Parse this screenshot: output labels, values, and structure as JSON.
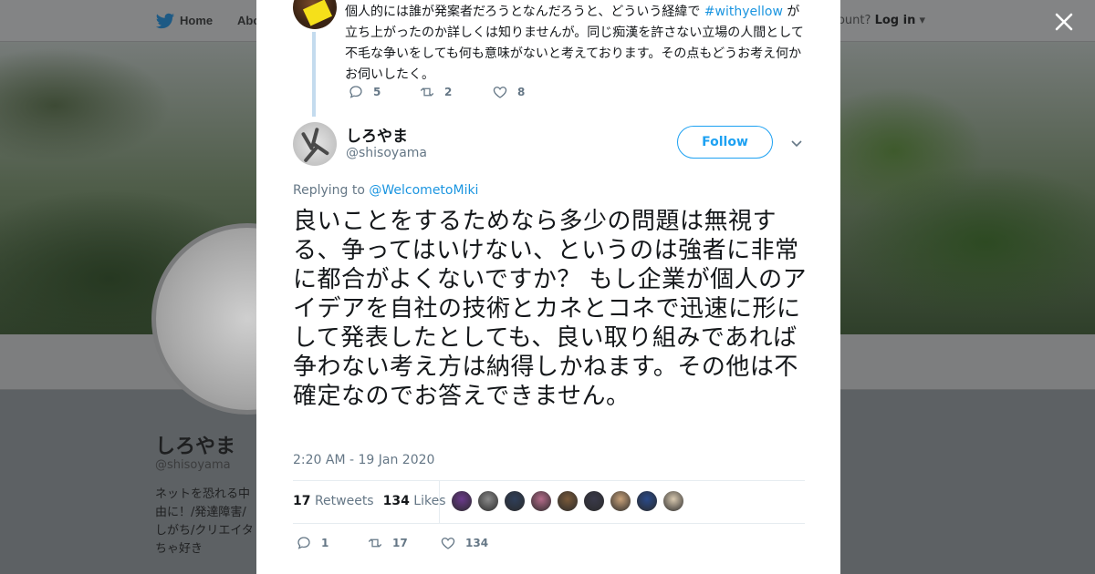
{
  "background": {
    "nav": {
      "home": "Home",
      "about": "Abo",
      "account_prompt": "ccount?",
      "login": "Log in"
    },
    "profile": {
      "name": "しろやま",
      "handle": "@shisoyama",
      "bio_lines": [
        "ネットを恐れる中",
        "由に！/発達障害/",
        "しがち/クリエイタ",
        "ちゃ好き"
      ]
    }
  },
  "modal": {
    "close_icon": "close-icon",
    "previous_tweet": {
      "text_before": "個人的には誰が発案者だろうとなんだろうと、どういう経緯で",
      "hashtag": "#withyellow",
      "text_after": "が立ち上がったのか詳しくは知りませんが。同じ痴漢を許さない立場の人間として不毛な争いをしても何も意味がないと考えております。その点もどうお考え何かお伺いしたく。",
      "replies": "5",
      "retweets": "2",
      "likes": "8"
    },
    "tweet": {
      "author_name": "しろやま",
      "author_handle": "@shisoyama",
      "follow_label": "Follow",
      "replying_prefix": "Replying to",
      "replying_to": "@WelcometoMiki",
      "text": "良いことをするためなら多少の問題は無視する、争ってはいけない、というのは強者に非常に都合がよくないですか？ もし企業が個人のアイデアを自社の技術とカネとコネで迅速に形にして発表したとしても、良い取り組みであれば争わない考え方は納得しかねます。その他は不確定なのでお答えできません。",
      "timestamp": "2:20 AM - 19 Jan 2020",
      "retweet_count": "17",
      "retweets_label": "Retweets",
      "like_count": "134",
      "likes_label": "Likes",
      "reply_count": "1",
      "action_retweets": "17",
      "action_likes": "134",
      "liker_colors": [
        "#6b3a8c",
        "#8a8a8a",
        "#2f3f5a",
        "#b56b8a",
        "#7a5a3a",
        "#3a3a4a",
        "#c9a27a",
        "#2a4a8a",
        "#d9c9b0"
      ]
    }
  }
}
